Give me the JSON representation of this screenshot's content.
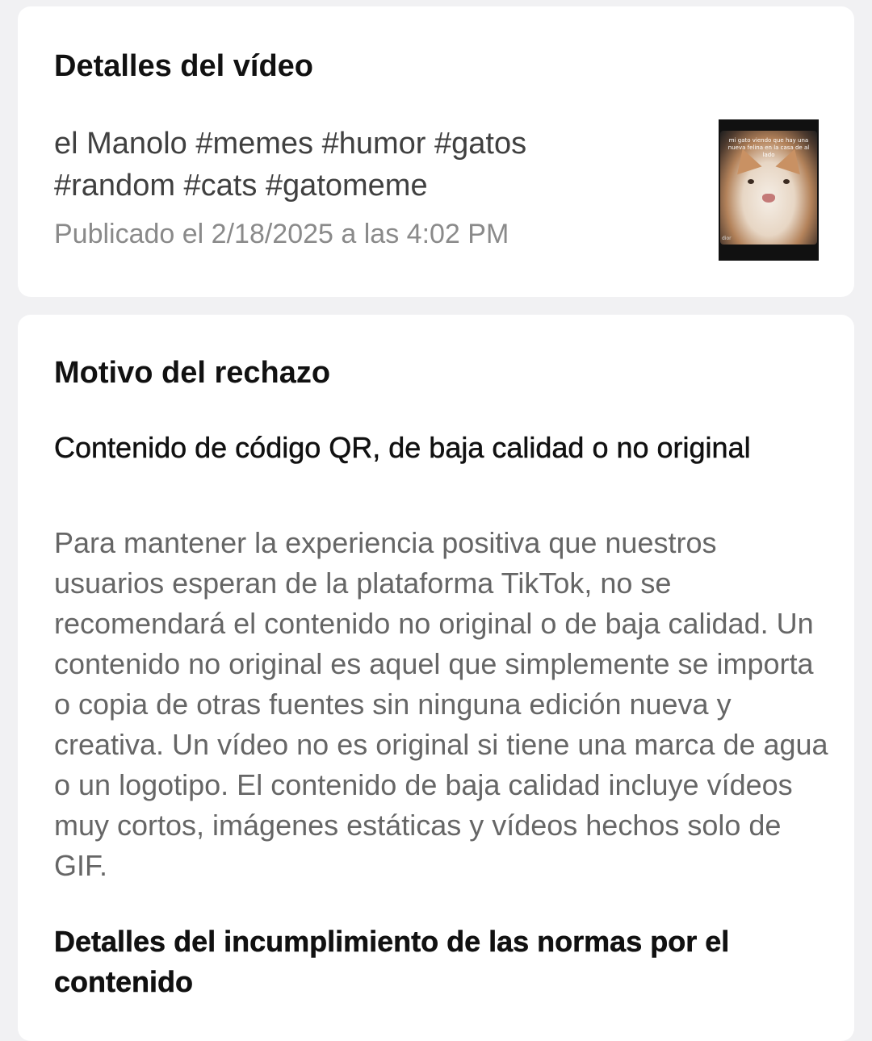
{
  "video_details": {
    "title": "Detalles del vídeo",
    "caption_line1": "el Manolo #memes #humor #gatos",
    "caption_line2": "#random #cats #gatomeme",
    "published": "Publicado el 2/18/2025 a las 4:02 PM",
    "thumbnail_overlay_text": "mi gato viendo que hay una nueva felina en la casa de al lado",
    "thumbnail_watermark": "dior"
  },
  "rejection": {
    "title": "Motivo del rechazo",
    "reason_title": "Contenido de código QR, de baja calidad o no original",
    "reason_body": "Para mantener la experiencia positiva que nuestros usuarios esperan de la plataforma TikTok, no se recomendará el contenido no original o de baja calidad. Un contenido no original es aquel que simplemente se importa o copia de otras fuentes sin ninguna edición nueva y creativa. Un vídeo no es original si tiene una marca de agua o un logotipo. El contenido de baja calidad incluye vídeos muy cortos, imágenes estáticas y vídeos hechos solo de GIF.",
    "violation_details_title": "Detalles del incumplimiento de las normas por el contenido"
  },
  "colors": {
    "background": "#f1f1f3",
    "card": "#ffffff",
    "title_text": "#111111",
    "body_text": "#666666",
    "meta_text": "#8a8a8a"
  }
}
